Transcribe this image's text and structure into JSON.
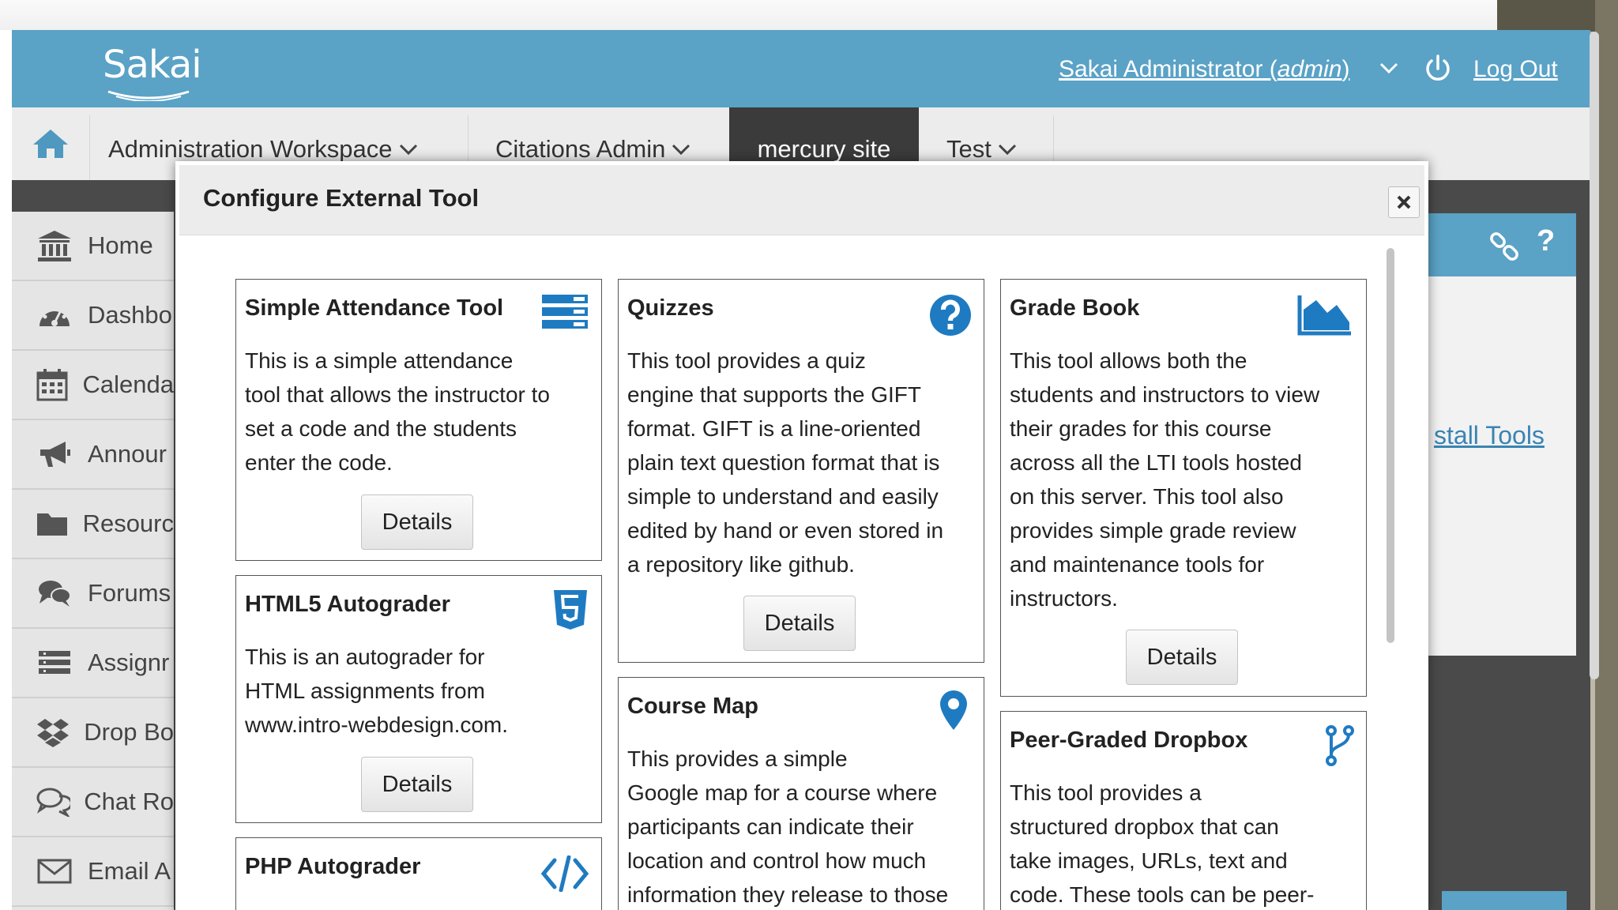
{
  "header": {
    "logo": "Sakai",
    "user_name": "Sakai Administrator (",
    "user_role": "admin",
    "user_close": ")",
    "logout": "Log Out"
  },
  "sitenav": {
    "tabs": [
      {
        "label": "Administration Workspace",
        "has_dropdown": true
      },
      {
        "label": "Citations Admin",
        "has_dropdown": true
      },
      {
        "label": "mercury site",
        "active": true
      },
      {
        "label": "Test",
        "has_dropdown": true
      }
    ]
  },
  "toolmenu": {
    "items": [
      {
        "label": "Home",
        "icon": "institution-icon"
      },
      {
        "label": "Dashbo",
        "icon": "dashboard-icon"
      },
      {
        "label": "Calenda",
        "icon": "calendar-icon"
      },
      {
        "label": "Annour",
        "icon": "megaphone-icon"
      },
      {
        "label": "Resourc",
        "icon": "folder-icon"
      },
      {
        "label": "Forums",
        "icon": "comments-icon"
      },
      {
        "label": "Assignr",
        "icon": "list-icon"
      },
      {
        "label": "Drop Bo",
        "icon": "dropbox-icon"
      },
      {
        "label": "Chat Ro",
        "icon": "chat-icon"
      },
      {
        "label": "Email A",
        "icon": "envelope-icon"
      }
    ]
  },
  "background": {
    "install_link": "stall Tools"
  },
  "modal": {
    "title": "Configure External Tool",
    "details_label": "Details",
    "tools": [
      {
        "title": "Simple Attendance Tool",
        "icon": "list-icon",
        "desc": [
          "This is a simple attendance",
          "tool that allows the instructor to",
          "set a code and the students",
          "enter the code."
        ]
      },
      {
        "title": "HTML5 Autograder",
        "icon": "html5-icon",
        "desc": [
          "This is an autograder for",
          "HTML assignments from",
          "www.intro-webdesign.com."
        ]
      },
      {
        "title": "PHP Autograder",
        "icon": "code-icon",
        "desc": []
      },
      {
        "title": "Quizzes",
        "icon": "question-circle-icon",
        "desc": [
          "This tool provides a quiz",
          "engine that supports the GIFT",
          "format. GIFT is a line-oriented",
          "plain text question format that is",
          "simple to understand and easily",
          "edited by hand or even stored in",
          "a repository like github."
        ]
      },
      {
        "title": "Course Map",
        "icon": "map-marker-icon",
        "desc": [
          "This provides a simple",
          "Google map for a course where",
          "participants can indicate their",
          "location and control how much",
          "information they release to those"
        ]
      },
      {
        "title": "Grade Book",
        "icon": "area-chart-icon",
        "desc": [
          "This tool allows both the",
          "students and instructors to view",
          "their grades for this course",
          "across all the LTI tools hosted",
          "on this server. This tool also",
          "provides simple grade review",
          "and maintenance tools for",
          "instructors."
        ]
      },
      {
        "title": "Peer-Graded Dropbox",
        "icon": "code-fork-icon",
        "desc": [
          "This tool provides a",
          "structured dropbox that can",
          "take images, URLs, text and",
          "code. These tools can be peer-"
        ]
      }
    ]
  },
  "colors": {
    "header_blue": "#5aa2c6",
    "icon_blue": "#1f7bc1",
    "active_tab": "#3b3b3b"
  }
}
